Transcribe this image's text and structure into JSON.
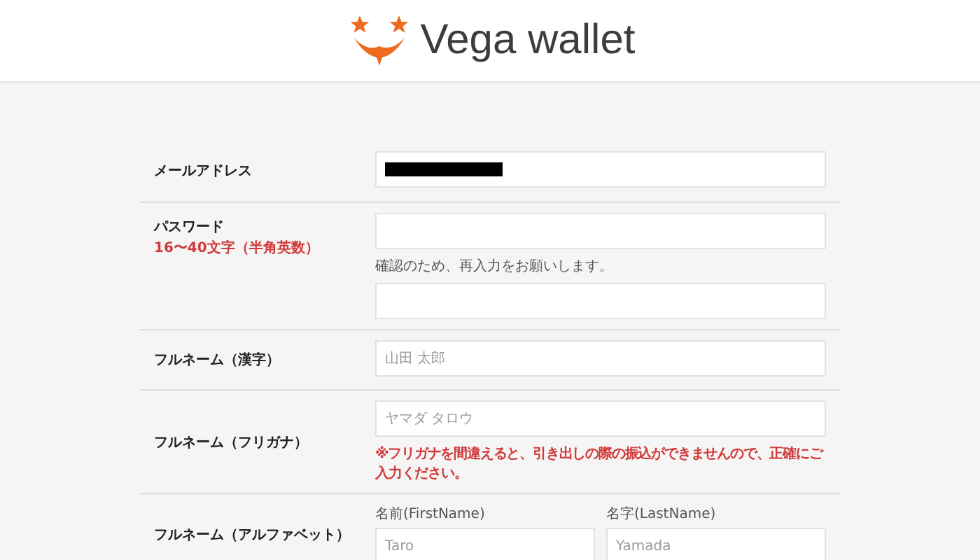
{
  "header": {
    "logo_text": "Vega wallet"
  },
  "rows": [
    {
      "kind": "email",
      "label": "メールアドレス",
      "redacted": true
    },
    {
      "kind": "password",
      "label": "パスワード",
      "note": "16〜40文字（半角英数）",
      "confirm_hint": "確認のため、再入力をお願いします。"
    },
    {
      "kind": "text",
      "label": "フルネーム（漢字）",
      "placeholder": "山田 太郎"
    },
    {
      "kind": "text",
      "label": "フルネーム（フリガナ）",
      "placeholder": "ヤマダ タロウ",
      "warning": "※フリガナを間違えると、引き出しの際の振込ができませんので、正確にご入力ください。"
    },
    {
      "kind": "pair",
      "label": "フルネーム（アルファベット）",
      "fields": [
        {
          "caption": "名前(FirstName)",
          "placeholder": "Taro"
        },
        {
          "caption": "名字(LastName)",
          "placeholder": "Yamada"
        }
      ]
    }
  ]
}
